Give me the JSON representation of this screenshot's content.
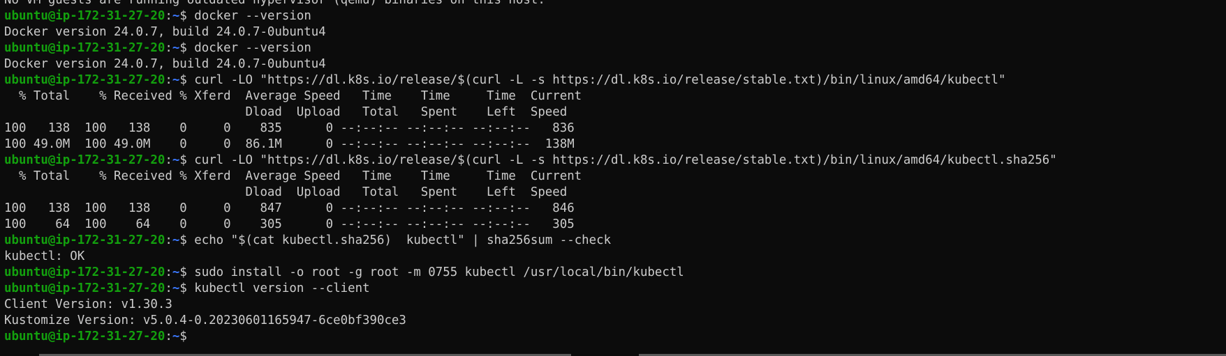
{
  "terminal": {
    "lines": [
      {
        "type": "out",
        "text": "No VM guests are running outdated hypervisor (qemu) binaries on this host."
      },
      {
        "type": "cmd",
        "user": "ubuntu@ip-172-31-27-20",
        "colon": ":",
        "path": "~",
        "prompt": "$ ",
        "cmd": "docker --version"
      },
      {
        "type": "out",
        "text": "Docker version 24.0.7, build 24.0.7-0ubuntu4"
      },
      {
        "type": "cmd",
        "user": "ubuntu@ip-172-31-27-20",
        "colon": ":",
        "path": "~",
        "prompt": "$ ",
        "cmd": "docker --version"
      },
      {
        "type": "out",
        "text": "Docker version 24.0.7, build 24.0.7-0ubuntu4"
      },
      {
        "type": "cmd",
        "user": "ubuntu@ip-172-31-27-20",
        "colon": ":",
        "path": "~",
        "prompt": "$ ",
        "cmd": "curl -LO \"https://dl.k8s.io/release/$(curl -L -s https://dl.k8s.io/release/stable.txt)/bin/linux/amd64/kubectl\""
      },
      {
        "type": "out",
        "text": "  % Total    % Received % Xferd  Average Speed   Time    Time     Time  Current"
      },
      {
        "type": "out",
        "text": "                                 Dload  Upload   Total   Spent    Left  Speed"
      },
      {
        "type": "out",
        "text": "100   138  100   138    0     0    835      0 --:--:-- --:--:-- --:--:--   836"
      },
      {
        "type": "out",
        "text": "100 49.0M  100 49.0M    0     0  86.1M      0 --:--:-- --:--:-- --:--:--  138M"
      },
      {
        "type": "cmd",
        "user": "ubuntu@ip-172-31-27-20",
        "colon": ":",
        "path": "~",
        "prompt": "$ ",
        "cmd": "curl -LO \"https://dl.k8s.io/release/$(curl -L -s https://dl.k8s.io/release/stable.txt)/bin/linux/amd64/kubectl.sha256\""
      },
      {
        "type": "out",
        "text": "  % Total    % Received % Xferd  Average Speed   Time    Time     Time  Current"
      },
      {
        "type": "out",
        "text": "                                 Dload  Upload   Total   Spent    Left  Speed"
      },
      {
        "type": "out",
        "text": "100   138  100   138    0     0    847      0 --:--:-- --:--:-- --:--:--   846"
      },
      {
        "type": "out",
        "text": "100    64  100    64    0     0    305      0 --:--:-- --:--:-- --:--:--   305"
      },
      {
        "type": "cmd",
        "user": "ubuntu@ip-172-31-27-20",
        "colon": ":",
        "path": "~",
        "prompt": "$ ",
        "cmd": "echo \"$(cat kubectl.sha256)  kubectl\" | sha256sum --check"
      },
      {
        "type": "out",
        "text": "kubectl: OK"
      },
      {
        "type": "cmd",
        "user": "ubuntu@ip-172-31-27-20",
        "colon": ":",
        "path": "~",
        "prompt": "$ ",
        "cmd": "sudo install -o root -g root -m 0755 kubectl /usr/local/bin/kubectl"
      },
      {
        "type": "cmd",
        "user": "ubuntu@ip-172-31-27-20",
        "colon": ":",
        "path": "~",
        "prompt": "$ ",
        "cmd": "kubectl version --client"
      },
      {
        "type": "out",
        "text": "Client Version: v1.30.3"
      },
      {
        "type": "out",
        "text": "Kustomize Version: v5.0.4-0.20230601165947-6ce0bf390ce3"
      },
      {
        "type": "cmd",
        "user": "ubuntu@ip-172-31-27-20",
        "colon": ":",
        "path": "~",
        "prompt": "$ ",
        "cmd": ""
      }
    ]
  },
  "colors": {
    "background": "#0c0c0c",
    "foreground": "#cccccc",
    "prompt_user": "#13a10e",
    "prompt_path": "#3b78ff",
    "scrollbar": "#5a5a5a"
  }
}
